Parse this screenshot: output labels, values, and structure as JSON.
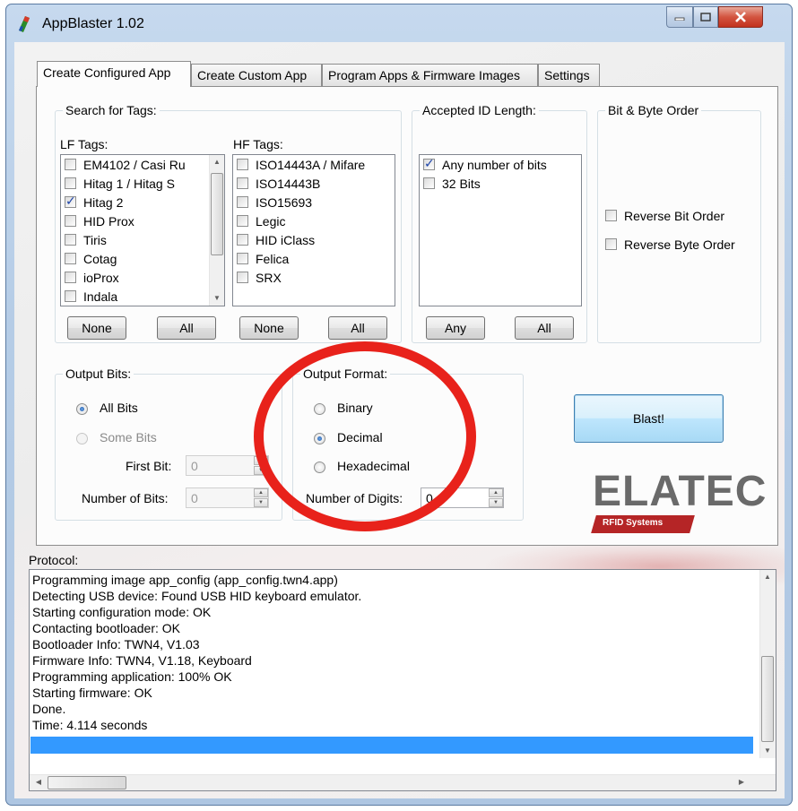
{
  "window": {
    "title": "AppBlaster 1.02"
  },
  "tabs": [
    {
      "label": "Create Configured App",
      "active": true
    },
    {
      "label": "Create Custom App",
      "active": false
    },
    {
      "label": "Program Apps & Firmware Images",
      "active": false
    },
    {
      "label": "Settings",
      "active": false
    }
  ],
  "search_tags": {
    "title": "Search for Tags:",
    "lf_label": "LF Tags:",
    "hf_label": "HF Tags:",
    "lf_items": [
      {
        "label": "EM4102 / Casi Ru",
        "checked": false
      },
      {
        "label": "Hitag 1 / Hitag S",
        "checked": false
      },
      {
        "label": "Hitag 2",
        "checked": true
      },
      {
        "label": "HID Prox",
        "checked": false
      },
      {
        "label": "Tiris",
        "checked": false
      },
      {
        "label": "Cotag",
        "checked": false
      },
      {
        "label": "ioProx",
        "checked": false
      },
      {
        "label": "Indala",
        "checked": false
      }
    ],
    "hf_items": [
      {
        "label": "ISO14443A / Mifare",
        "checked": false
      },
      {
        "label": "ISO14443B",
        "checked": false
      },
      {
        "label": "ISO15693",
        "checked": false
      },
      {
        "label": "Legic",
        "checked": false
      },
      {
        "label": "HID iClass",
        "checked": false
      },
      {
        "label": "Felica",
        "checked": false
      },
      {
        "label": "SRX",
        "checked": false
      }
    ],
    "lf_none": "None",
    "lf_all": "All",
    "hf_none": "None",
    "hf_all": "All"
  },
  "id_length": {
    "title": "Accepted ID Length:",
    "items": [
      {
        "label": "Any number of bits",
        "checked": true
      },
      {
        "label": "32 Bits",
        "checked": false
      }
    ],
    "any_button": "Any",
    "all_button": "All"
  },
  "bit_byte_order": {
    "title": "Bit & Byte Order",
    "reverse_bit": "Reverse Bit Order",
    "reverse_byte": "Reverse Byte Order"
  },
  "output_bits": {
    "title": "Output Bits:",
    "all_bits": "All Bits",
    "some_bits": "Some Bits",
    "first_bit_label": "First Bit:",
    "first_bit_value": "0",
    "num_bits_label": "Number of Bits:",
    "num_bits_value": "0"
  },
  "output_format": {
    "title": "Output Format:",
    "binary": "Binary",
    "decimal": "Decimal",
    "hexadecimal": "Hexadecimal",
    "digits_label": "Number of Digits:",
    "digits_value": "0"
  },
  "blast_button": "Blast!",
  "logo": {
    "text": "ELATEC",
    "subtitle": "RFID Systems",
    "color": "#6a6a6a",
    "bar_color": "#b52526"
  },
  "protocol": {
    "label": "Protocol:",
    "lines": [
      "Programming image app_config (app_config.twn4.app)",
      "Detecting USB device: Found USB HID keyboard emulator.",
      "Starting configuration mode: OK",
      "Contacting bootloader: OK",
      "Bootloader Info: TWN4, V1.03",
      "Firmware Info: TWN4, V1.18, Keyboard",
      "Programming application: 100% OK",
      "Starting firmware: OK",
      "Done.",
      "Time: 4.114 seconds"
    ]
  },
  "colors": {
    "highlight_circle": "#e8221b",
    "selection": "#3399ff"
  }
}
